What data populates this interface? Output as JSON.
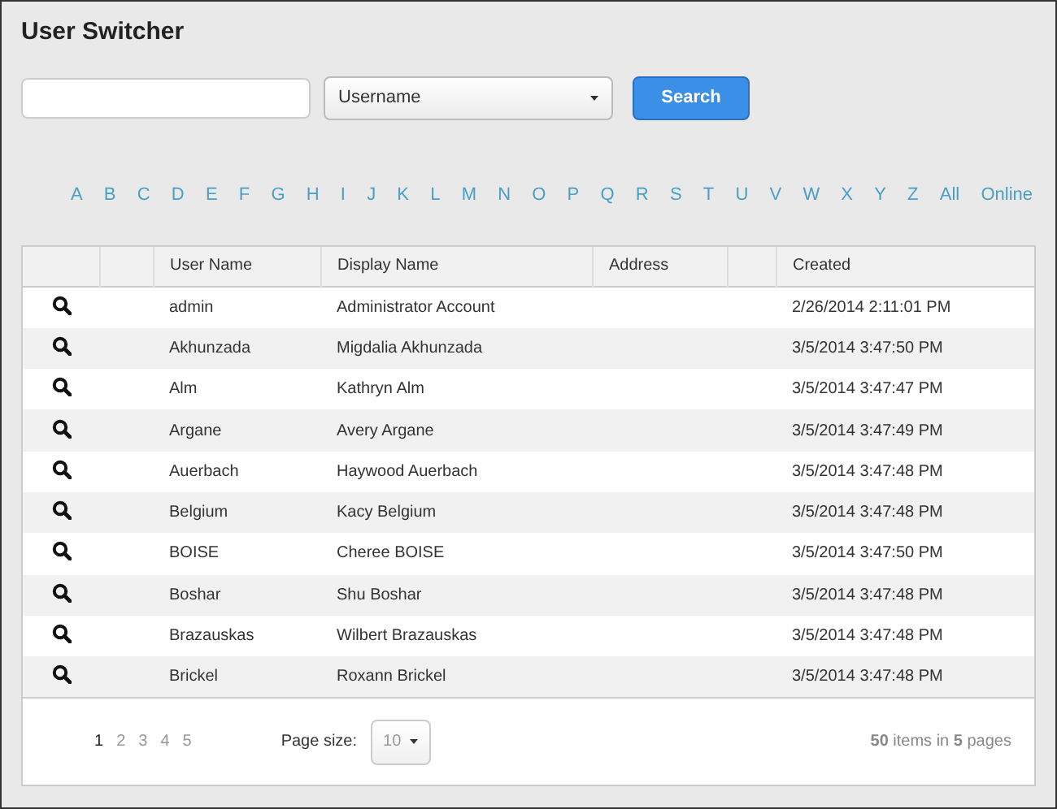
{
  "title": "User Switcher",
  "search": {
    "filter": "Username",
    "button": "Search"
  },
  "letters": [
    {
      "label": "A",
      "selected": false
    },
    {
      "label": "B",
      "selected": false
    },
    {
      "label": "C",
      "selected": false
    },
    {
      "label": "D",
      "selected": false
    },
    {
      "label": "E",
      "selected": false
    },
    {
      "label": "F",
      "selected": false
    },
    {
      "label": "G",
      "selected": false
    },
    {
      "label": "H",
      "selected": false
    },
    {
      "label": "I",
      "selected": false
    },
    {
      "label": "J",
      "selected": false
    },
    {
      "label": "K",
      "selected": false
    },
    {
      "label": "L",
      "selected": false
    },
    {
      "label": "M",
      "selected": false
    },
    {
      "label": "N",
      "selected": false
    },
    {
      "label": "O",
      "selected": false
    },
    {
      "label": "P",
      "selected": false
    },
    {
      "label": "Q",
      "selected": false
    },
    {
      "label": "R",
      "selected": false
    },
    {
      "label": "S",
      "selected": false
    },
    {
      "label": "T",
      "selected": false
    },
    {
      "label": "U",
      "selected": false
    },
    {
      "label": "V",
      "selected": false
    },
    {
      "label": "W",
      "selected": false
    },
    {
      "label": "X",
      "selected": false
    },
    {
      "label": "Y",
      "selected": false
    },
    {
      "label": "Z",
      "selected": false
    },
    {
      "label": "All",
      "selected": false
    },
    {
      "label": "Online",
      "selected": false
    }
  ],
  "table": {
    "columns": [
      "User Name",
      "Display Name",
      "Address",
      "Created"
    ],
    "rows": [
      {
        "user_name": "admin",
        "display_name": "Administrator Account",
        "created": "2/26/2014 2:11:01 PM"
      },
      {
        "user_name": "Akhunzada",
        "display_name": "Migdalia Akhunzada",
        "created": "3/5/2014 3:47:50 PM"
      },
      {
        "user_name": "Alm",
        "display_name": "Kathryn Alm",
        "created": "3/5/2014 3:47:47 PM"
      },
      {
        "user_name": "Argane",
        "display_name": "Avery Argane",
        "created": "3/5/2014 3:47:49 PM"
      },
      {
        "user_name": "Auerbach",
        "display_name": "Haywood Auerbach",
        "created": "3/5/2014 3:47:48 PM"
      },
      {
        "user_name": "Belgium",
        "display_name": "Kacy Belgium",
        "created": "3/5/2014 3:47:48 PM"
      },
      {
        "user_name": "BOISE",
        "display_name": "Cheree BOISE",
        "created": "3/5/2014 3:47:50 PM"
      },
      {
        "user_name": "Boshar",
        "display_name": "Shu Boshar",
        "created": "3/5/2014 3:47:48 PM"
      },
      {
        "user_name": "Brazauskas",
        "display_name": "Wilbert Brazauskas",
        "created": "3/5/2014 3:47:48 PM"
      },
      {
        "user_name": "Brickel",
        "display_name": "Roxann Brickel",
        "created": "3/5/2014 3:47:48 PM"
      }
    ]
  },
  "pager": {
    "pages": [
      {
        "label": "1",
        "selected": true
      },
      {
        "label": "2",
        "selected": false
      },
      {
        "label": "3",
        "selected": false
      },
      {
        "label": "4",
        "selected": false
      },
      {
        "label": "5",
        "selected": false
      }
    ],
    "page_size_label": "Page size:",
    "page_size": "10",
    "summary": "**50** items in **5** pages"
  }
}
